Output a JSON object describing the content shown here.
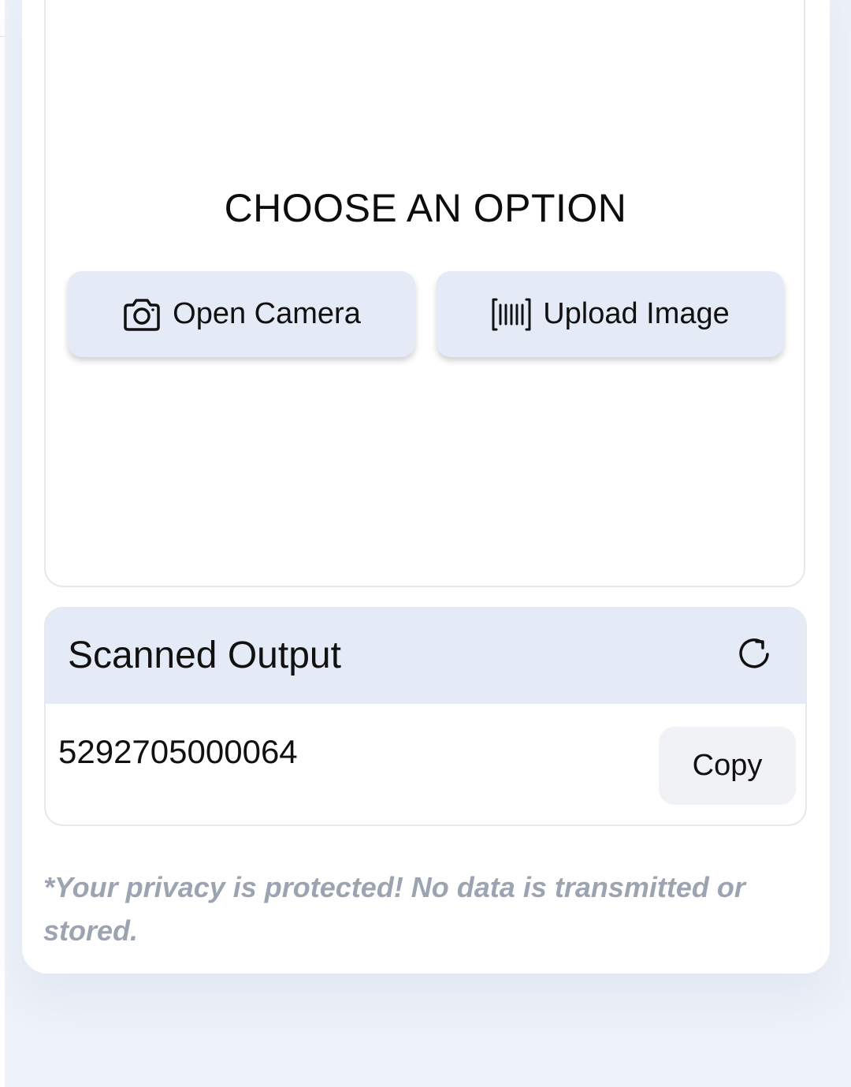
{
  "scanner": {
    "title": "CHOOSE AN OPTION",
    "open_camera_label": "Open Camera",
    "open_camera_icon": "camera-icon",
    "upload_image_label": "Upload Image",
    "upload_image_icon": "barcode-icon"
  },
  "output": {
    "title": "Scanned Output",
    "refresh_icon": "refresh-icon",
    "value": "5292705000064",
    "copy_label": "Copy"
  },
  "privacy_note": "*Your privacy is protected! No data is transmitted or stored.",
  "colors": {
    "button_bg": "#e5eaf7",
    "page_bg": "#eef2f9",
    "note_text": "#9ca4b1"
  }
}
